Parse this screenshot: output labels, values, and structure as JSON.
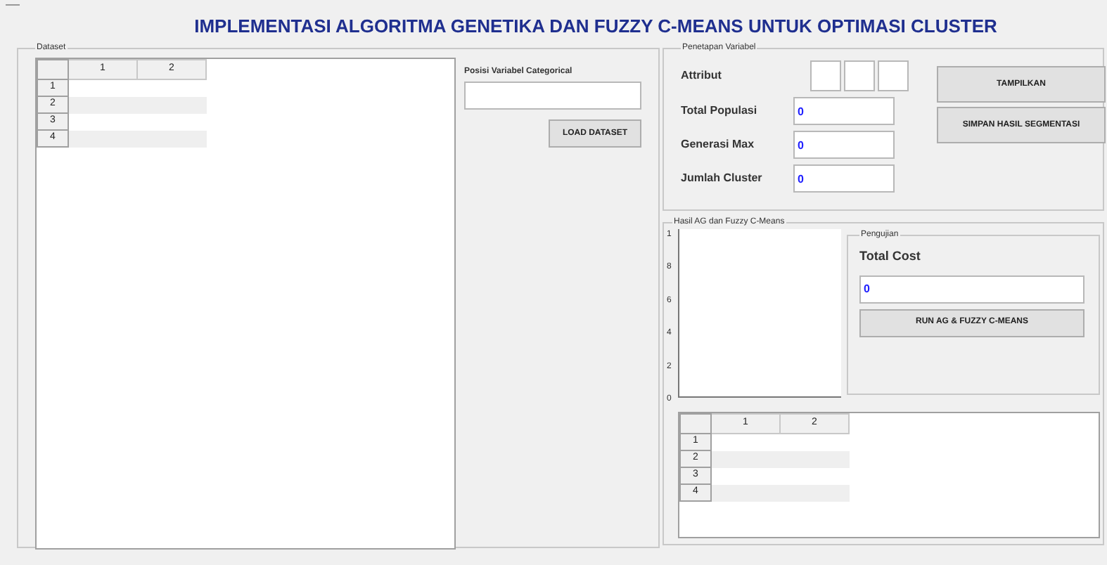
{
  "title": "IMPLEMENTASI ALGORITMA GENETIKA DAN FUZZY C-MEANS UNTUK OPTIMASI CLUSTER",
  "dataset": {
    "legend": "Dataset",
    "table": {
      "columns": [
        "1",
        "2"
      ],
      "rows": [
        "1",
        "2",
        "3",
        "4"
      ]
    },
    "categorical_label": "Posisi Variabel Categorical",
    "load_button": "LOAD DATASET"
  },
  "penetapan": {
    "legend": "Penetapan Variabel",
    "attribut_label": "Attribut",
    "attribut_fields": [
      {
        "kind": "empty"
      },
      {
        "kind": "empty"
      },
      {
        "kind": "empty"
      }
    ],
    "fields": [
      {
        "label": "Total Populasi",
        "value": "0"
      },
      {
        "label": "Generasi Max",
        "value": "0"
      },
      {
        "label": "Jumlah Cluster",
        "value": "0"
      }
    ],
    "buttons": [
      "TAMPILKAN",
      "SIMPAN HASIL SEGMENTASI"
    ]
  },
  "hasil": {
    "legend": "Hasil AG dan Fuzzy C-Means",
    "axis_ticks": [
      "1",
      "8",
      "6",
      "4",
      "2",
      "0"
    ],
    "pengujian": {
      "legend": "Pengujian",
      "label": "Total Cost",
      "value": "0",
      "button": "RUN AG & FUZZY C-MEANS"
    },
    "table": {
      "columns": [
        "1",
        "2"
      ],
      "rows": [
        "1",
        "2",
        "3",
        "4"
      ]
    }
  }
}
